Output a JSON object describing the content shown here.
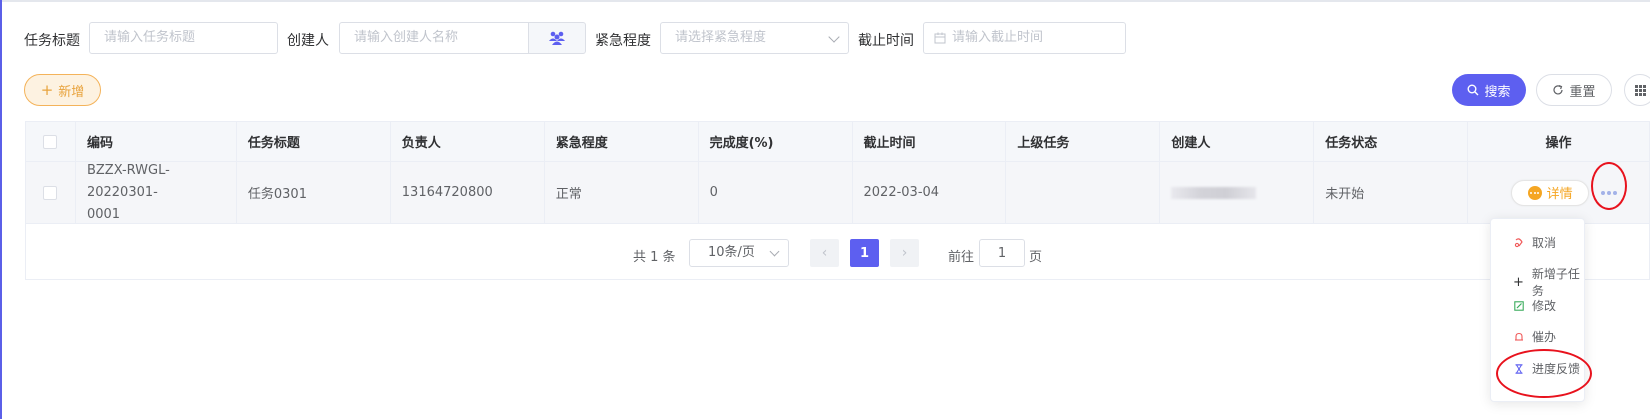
{
  "search_form": {
    "title_label": "任务标题",
    "title_placeholder": "请输入任务标题",
    "creator_label": "创建人",
    "creator_placeholder": "请输入创建人名称",
    "urgency_label": "紧急程度",
    "urgency_placeholder": "请选择紧急程度",
    "deadline_label": "截止时间",
    "deadline_placeholder": "请输入截止时间"
  },
  "toolbar": {
    "add_label": "新增",
    "search_label": "搜索",
    "reset_label": "重置"
  },
  "table": {
    "columns": [
      "编码",
      "任务标题",
      "负责人",
      "紧急程度",
      "完成度(%)",
      "截止时间",
      "上级任务",
      "创建人",
      "任务状态",
      "操作"
    ],
    "rows": [
      {
        "code_line1": "BZZX-RWGL-20220301-",
        "code_line2": "0001",
        "title": "任务0301",
        "owner": "13164720800",
        "urgency": "正常",
        "progress": "0",
        "deadline": "2022-03-04",
        "parent_task": "",
        "creator": "",
        "status": "未开始",
        "detail_label": "详情"
      }
    ]
  },
  "pagination": {
    "total": "共 1 条",
    "page_size": "10条/页",
    "current_page": "1",
    "goto_label": "前往",
    "goto_value": "1",
    "page_suffix": "页"
  },
  "dropdown_menu": {
    "items": [
      "取消",
      "新增子任务",
      "修改",
      "催办",
      "进度反馈"
    ]
  },
  "colors": {
    "primary": "#5d5ff0",
    "warning": "#f5a623",
    "annotation": "#e8121d"
  }
}
